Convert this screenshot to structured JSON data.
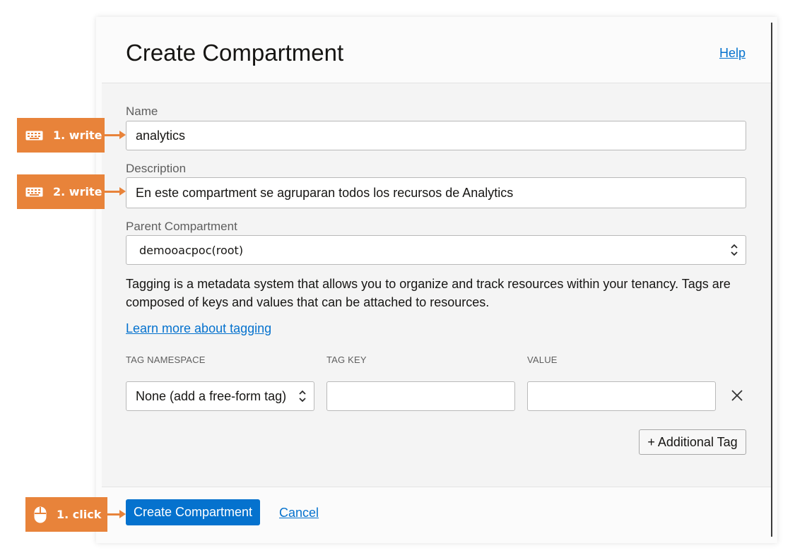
{
  "dialog": {
    "title": "Create Compartment",
    "help_link": "Help"
  },
  "form": {
    "name": {
      "label": "Name",
      "value": "analytics"
    },
    "description": {
      "label": "Description",
      "value": "En este compartment se agruparan todos los recursos de Analytics"
    },
    "parent": {
      "label": "Parent Compartment",
      "value": "demooacpoc(root)"
    }
  },
  "tagging": {
    "help_text": "Tagging is a metadata system that allows you to organize and track resources within your tenancy. Tags are composed of keys and values that can be attached to resources.",
    "learn_more": "Learn more about tagging",
    "columns": {
      "namespace": "TAG NAMESPACE",
      "key": "TAG KEY",
      "value": "VALUE"
    },
    "row": {
      "namespace": "None (add a free-form tag)",
      "key": "",
      "value": ""
    },
    "add_button": "+ Additional Tag"
  },
  "footer": {
    "create_button": "Create Compartment",
    "cancel_link": "Cancel"
  },
  "callouts": [
    {
      "icon": "keyboard-icon",
      "text": "1. write"
    },
    {
      "icon": "keyboard-icon",
      "text": "2. write"
    },
    {
      "icon": "mouse-icon",
      "text": "1. click"
    }
  ],
  "colors": {
    "accent": "#0572ce",
    "callout": "#e8833a"
  }
}
